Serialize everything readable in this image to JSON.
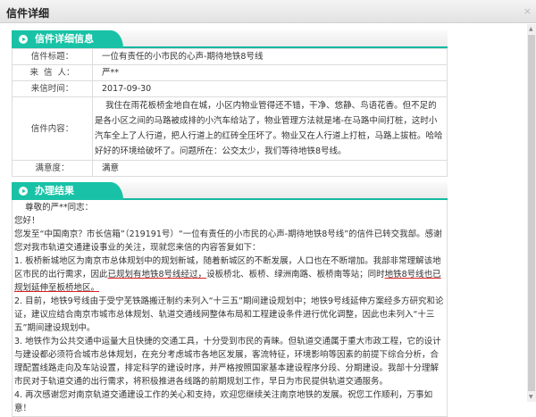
{
  "window": {
    "title": "信件详细",
    "close": "×"
  },
  "detail": {
    "heading": "信件详细信息",
    "rows": [
      {
        "label": "信件标题：",
        "value": "一位有责任的小市民的心声-期待地铁8号线"
      },
      {
        "label": "来  信  人：",
        "value": "严**"
      },
      {
        "label": "来信时间：",
        "value": "2017-09-30"
      },
      {
        "label": "信件内容：",
        "value": "    我住在雨花板桥金地自在城，小区内物业管得还不错，干净、悠静、鸟语花香。但不足的是各小区之间的马路被成排的小汽车给站了，物业管理方法就是堵-在马路中间打桩，这时小汽车全上了人行道，把人行道上的红砖全压坏了。物业又在人行道上打桩，马路上拔桩。哈哈好好的环境给破坏了。问题所在：公交太少，我们等待地铁8号线。"
      },
      {
        "label": "满意度：",
        "value": "满意"
      }
    ]
  },
  "result": {
    "heading": "办理结果",
    "greeting": "    尊敬的严**同志：",
    "hello": "您好！",
    "intro": "您发至“中国南京？市长信箱”（219191号）“一位有责任的小市民的心声-期待地铁8号线”的信件已转交我部。感谢您对我市轨道交通建设事业的关注，现就您来信的内容答复如下：",
    "p1a": "1. 板桥新城地区为南京市总体规划中的规划新城，随着新城区的不断发展，人口也在不断增加。我部非常理解该地区市民的出行需求，因此",
    "p1b": "已规划有地铁8号线经过，",
    "p1c": "设板桥北、板桥、绿洲南路、板桥南等站；同时",
    "p1d": "地铁8号线也已规划延伸至板桥地区。",
    "p2": "2. 目前，地铁9号线由于受宁芜铁路搬迁制约未列入“十三五”期间建设规划中；地铁9号线延伸方案经多方研究和论证，建议应结合南京市城市总体规划、轨道交通线网整体布局和工程建设条件进行优化调整，因此也未列入“十三五”期间建设规划中。",
    "p3": "3. 地铁作为公共交通中运量大且快捷的交通工具，十分受到市民的青睐。但轨道交通属于重大市政工程，它的设计与建设都必须符合城市总体规划，在充分考虑城市各地区发展，客流特征，环境影响等因素的前提下综合分析，合理配置线路走向及车站设置，排定科学的建设时序，并严格按照国家基本建设程序分段、分期建设。我部十分理解市民对于轨道交通的出行需求，将积极推进各线路的前期规划工作，早日为市民提供轨道交通服务。",
    "p4": "4. 再次感谢您对南京轨道交通建设工作的关心和支持，欢迎您继续关注南京地铁的发展。祝您工作顺利，万事如意！"
  }
}
